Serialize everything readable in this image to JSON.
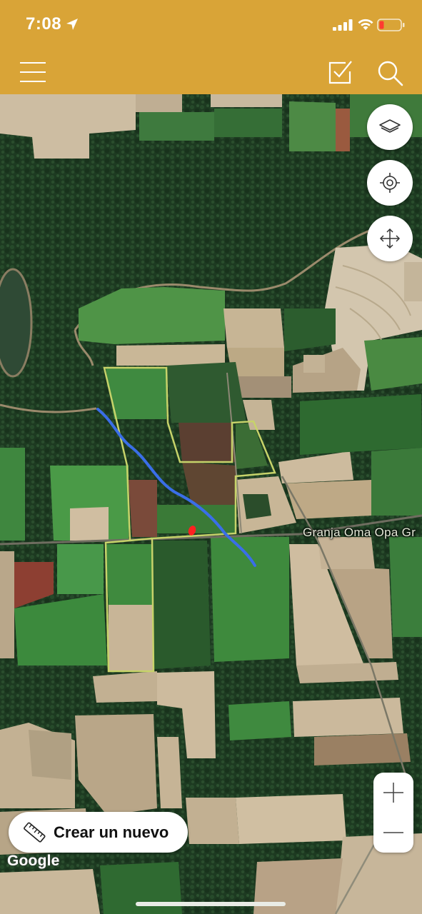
{
  "status_bar": {
    "time": "7:08",
    "battery_color": "#ff3b30"
  },
  "toolbar": {
    "background": "#d9a437",
    "icons": [
      "menu-icon",
      "checkbox-edit-icon",
      "search-icon"
    ]
  },
  "map": {
    "road_label": "Granja Oma Opa Gr",
    "attribution": "Google",
    "parcel_outline_color": "#c7d36a",
    "stream_color": "#3a6ee8",
    "marker_color": "#ff2020"
  },
  "map_controls": {
    "icons": [
      "layers-icon",
      "locate-icon",
      "move-icon"
    ],
    "zoom_in": "+",
    "zoom_out": "—"
  },
  "create_button": {
    "label": "Crear un nuevo",
    "icon": "ruler-icon"
  }
}
